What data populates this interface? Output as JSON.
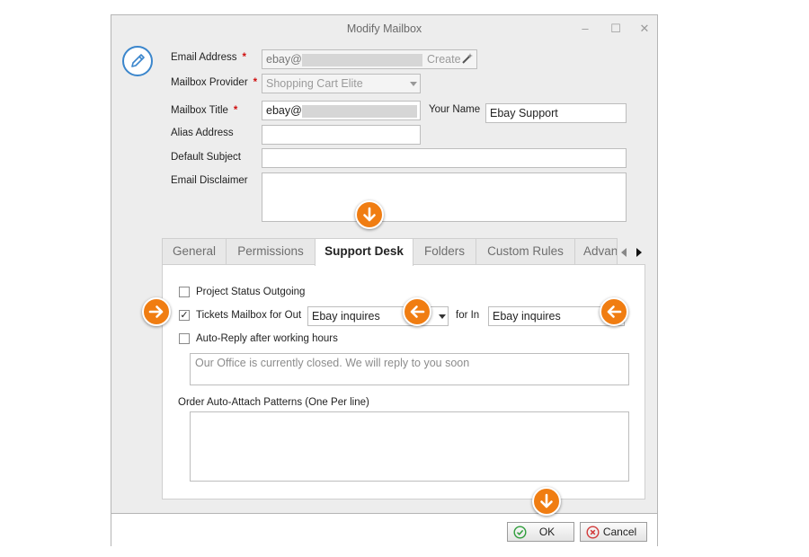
{
  "window": {
    "title": "Modify Mailbox",
    "controls": {
      "minimize": "–",
      "maximize": "☐",
      "close": "✕"
    }
  },
  "form": {
    "email_address": {
      "label": "Email Address",
      "required": "*",
      "value": "ebay@",
      "create_label": "Create"
    },
    "mailbox_provider": {
      "label": "Mailbox Provider",
      "required": "*",
      "value": "Shopping Cart Elite"
    },
    "mailbox_title": {
      "label": "Mailbox Title",
      "required": "*",
      "value": "ebay@"
    },
    "your_name": {
      "label": "Your Name",
      "value": "Ebay Support"
    },
    "alias_address": {
      "label": "Alias Address",
      "value": ""
    },
    "default_subject": {
      "label": "Default Subject",
      "value": ""
    },
    "email_disclaimer": {
      "label": "Email Disclaimer",
      "value": ""
    }
  },
  "tabs": [
    {
      "label": "General"
    },
    {
      "label": "Permissions"
    },
    {
      "label": "Support Desk"
    },
    {
      "label": "Folders"
    },
    {
      "label": "Custom Rules"
    },
    {
      "label": "Advan"
    }
  ],
  "active_tab": "Support Desk",
  "support_desk": {
    "project_status": {
      "label": "Project Status Outgoing",
      "checked": false
    },
    "tickets_mailbox": {
      "label": "Tickets Mailbox for Out",
      "checked": true,
      "check_mark": "✓",
      "out_value": "Ebay inquires",
      "for_in_label": "for In",
      "in_value": "Ebay inquires"
    },
    "auto_reply": {
      "label": "Auto-Reply after working hours",
      "checked": false,
      "message_placeholder": "Our Office is currently closed. We will reply to you soon"
    },
    "order_patterns": {
      "label": "Order Auto-Attach Patterns (One Per line)",
      "value": ""
    }
  },
  "buttons": {
    "ok": "OK",
    "cancel": "Cancel"
  },
  "colors": {
    "accent_orange": "#f07d12",
    "required_red": "#d01010",
    "edit_icon_blue": "#3b86cc",
    "ok_green": "#2e9d3a",
    "cancel_red": "#d23a3a"
  },
  "icons": [
    "edit-icon",
    "wand-icon",
    "arrow-down-icon",
    "arrow-right-icon",
    "arrow-left-icon",
    "check-circle-icon",
    "x-circle-icon",
    "chevron-left-icon",
    "chevron-right-icon"
  ]
}
